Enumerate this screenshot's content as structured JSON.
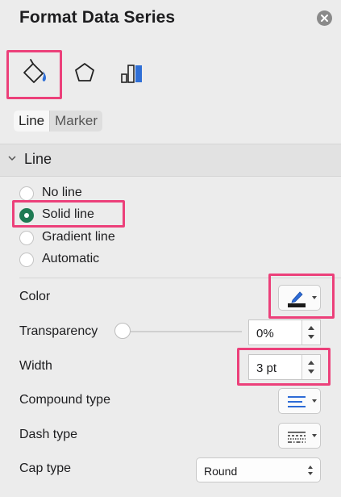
{
  "panel": {
    "title": "Format Data Series"
  },
  "tabs": [
    {
      "name": "Fill & Line",
      "selected": true
    },
    {
      "name": "Effects",
      "selected": false
    },
    {
      "name": "Series Options",
      "selected": false
    }
  ],
  "segmented": {
    "items": [
      "Line",
      "Marker"
    ],
    "selected": "Line"
  },
  "section": {
    "label": "Line",
    "expanded": true
  },
  "line_options": [
    {
      "label": "No line",
      "selected": false
    },
    {
      "label": "Solid line",
      "selected": true
    },
    {
      "label": "Gradient line",
      "selected": false
    },
    {
      "label": "Automatic",
      "selected": false
    }
  ],
  "properties": {
    "color": {
      "label": "Color",
      "value_color": "#1a1a1a",
      "pen_color": "#2d6bd6"
    },
    "transparency": {
      "label": "Transparency",
      "value": "0%",
      "fraction": 0
    },
    "width": {
      "label": "Width",
      "value": "3 pt"
    },
    "compound": {
      "label": "Compound type"
    },
    "dash": {
      "label": "Dash type"
    },
    "cap": {
      "label": "Cap type",
      "value": "Round"
    }
  },
  "colors": {
    "accent": "#1f7a53",
    "highlight": "#ec407a"
  }
}
